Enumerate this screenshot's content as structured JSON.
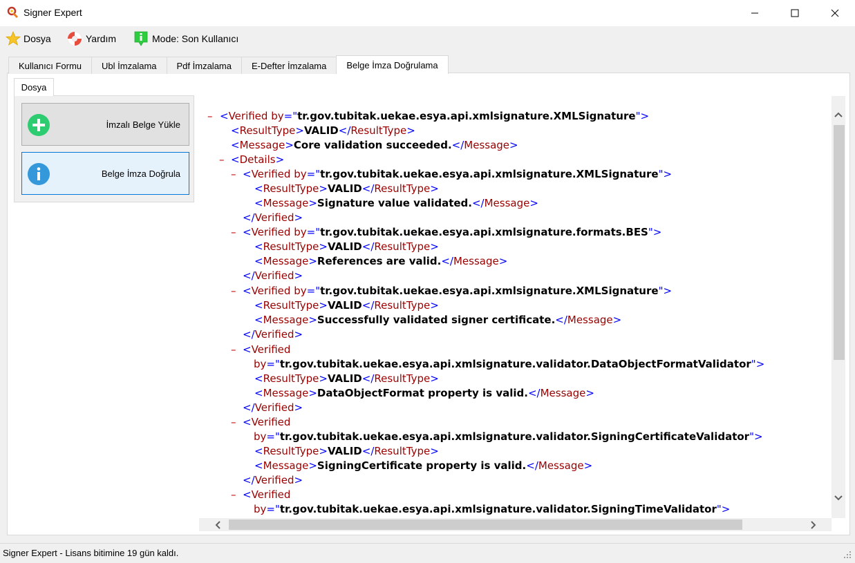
{
  "window": {
    "title": "Signer Expert"
  },
  "menu": {
    "file": "Dosya",
    "help": "Yardım",
    "mode": "Mode: Son Kullanıcı"
  },
  "tabs": [
    "Kullanıcı Formu",
    "Ubl İmzalama",
    "Pdf İmzalama",
    "E-Defter İmzalama",
    "Belge İmza Doğrulama"
  ],
  "active_tab": "Belge İmza Doğrulama",
  "inner_tab": "Dosya",
  "actions": {
    "load": "İmzalı Belge Yükle",
    "verify": "Belge İmza Doğrula"
  },
  "xml": {
    "attr_by": "by",
    "sig_xmlsignature": "tr.gov.tubitak.uekae.esya.api.xmlsignature.XMLSignature",
    "sig_bes": "tr.gov.tubitak.uekae.esya.api.xmlsignature.formats.BES",
    "sig_dataobject": "tr.gov.tubitak.uekae.esya.api.xmlsignature.validator.DataObjectFormatValidator",
    "sig_signingcert": "tr.gov.tubitak.uekae.esya.api.xmlsignature.validator.SigningCertificateValidator",
    "sig_signingtime": "tr.gov.tubitak.uekae.esya.api.xmlsignature.validator.SigningTimeValidator",
    "tag_verified": "Verified",
    "tag_resulttype": "ResultType",
    "tag_message": "Message",
    "tag_details": "Details",
    "valid": "VALID",
    "msg_core": "Core validation succeeded.",
    "msg_sigvalue": "Signature value validated.",
    "msg_refs": "References are valid.",
    "msg_signer": "Successfully validated signer certificate.",
    "msg_dataobject": "DataObjectFormat property is valid.",
    "msg_signingcert": "SigningCertificate property is valid."
  },
  "status": {
    "text": "Signer Expert - Lisans bitimine 19 gün kaldı."
  }
}
